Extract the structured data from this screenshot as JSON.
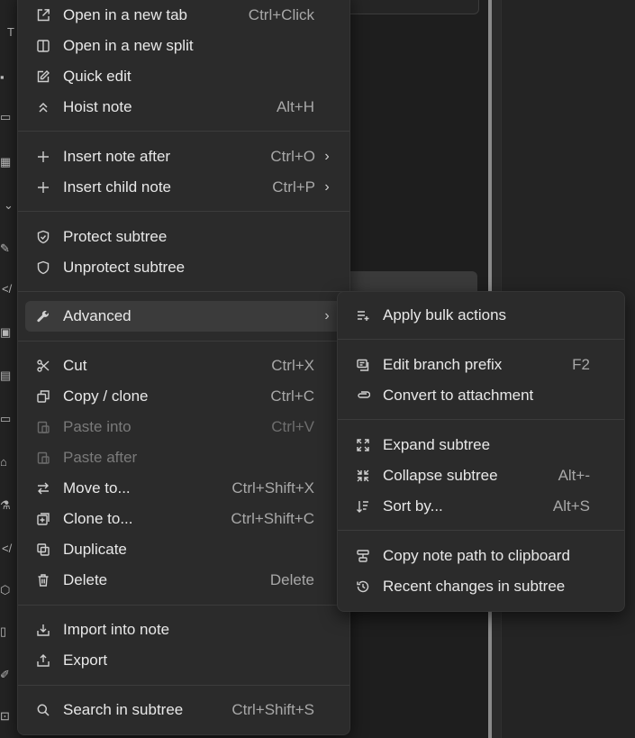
{
  "main_menu": {
    "items": [
      {
        "label": "Open in a new tab",
        "shortcut": "Ctrl+Click",
        "icon": "external-link-icon"
      },
      {
        "label": "Open in a new split",
        "shortcut": "",
        "icon": "split-panel-icon"
      },
      {
        "label": "Quick edit",
        "shortcut": "",
        "icon": "edit-icon"
      },
      {
        "label": "Hoist note",
        "shortcut": "Alt+H",
        "icon": "hoist-icon"
      },
      {
        "label": "Insert note after",
        "shortcut": "Ctrl+O",
        "icon": "plus-icon"
      },
      {
        "label": "Insert child note",
        "shortcut": "Ctrl+P",
        "icon": "plus-icon"
      },
      {
        "label": "Protect subtree",
        "shortcut": "",
        "icon": "shield-check-icon"
      },
      {
        "label": "Unprotect subtree",
        "shortcut": "",
        "icon": "shield-icon"
      },
      {
        "label": "Advanced",
        "shortcut": "",
        "icon": "wrench-icon"
      },
      {
        "label": "Cut",
        "shortcut": "Ctrl+X",
        "icon": "scissors-icon"
      },
      {
        "label": "Copy / clone",
        "shortcut": "Ctrl+C",
        "icon": "copy-icon"
      },
      {
        "label": "Paste into",
        "shortcut": "Ctrl+V",
        "icon": "paste-icon"
      },
      {
        "label": "Paste after",
        "shortcut": "",
        "icon": "paste-icon"
      },
      {
        "label": "Move to...",
        "shortcut": "Ctrl+Shift+X",
        "icon": "transfer-icon"
      },
      {
        "label": "Clone to...",
        "shortcut": "Ctrl+Shift+C",
        "icon": "clone-icon"
      },
      {
        "label": "Duplicate",
        "shortcut": "",
        "icon": "duplicate-icon"
      },
      {
        "label": "Delete",
        "shortcut": "Delete",
        "icon": "trash-icon"
      },
      {
        "label": "Import into note",
        "shortcut": "",
        "icon": "import-icon"
      },
      {
        "label": "Export",
        "shortcut": "",
        "icon": "export-icon"
      },
      {
        "label": "Search in subtree",
        "shortcut": "Ctrl+Shift+S",
        "icon": "search-icon"
      }
    ]
  },
  "sub_menu": {
    "items": [
      {
        "label": "Apply bulk actions",
        "shortcut": "",
        "icon": "bulk-actions-icon"
      },
      {
        "label": "Edit branch prefix",
        "shortcut": "F2",
        "icon": "branch-prefix-icon"
      },
      {
        "label": "Convert to attachment",
        "shortcut": "",
        "icon": "paperclip-icon"
      },
      {
        "label": "Expand subtree",
        "shortcut": "",
        "icon": "expand-icon"
      },
      {
        "label": "Collapse subtree",
        "shortcut": "Alt+-",
        "icon": "collapse-icon"
      },
      {
        "label": "Sort by...",
        "shortcut": "Alt+S",
        "icon": "sort-icon"
      },
      {
        "label": "Copy note path to clipboard",
        "shortcut": "",
        "icon": "path-icon"
      },
      {
        "label": "Recent changes in subtree",
        "shortcut": "",
        "icon": "history-icon"
      }
    ]
  },
  "colors": {
    "menu_bg": "#2b2b2b",
    "active_bg": "#3b3b3b",
    "text": "#e8e8e8",
    "muted": "#a8a8a8",
    "disabled": "#7a7a7a"
  }
}
